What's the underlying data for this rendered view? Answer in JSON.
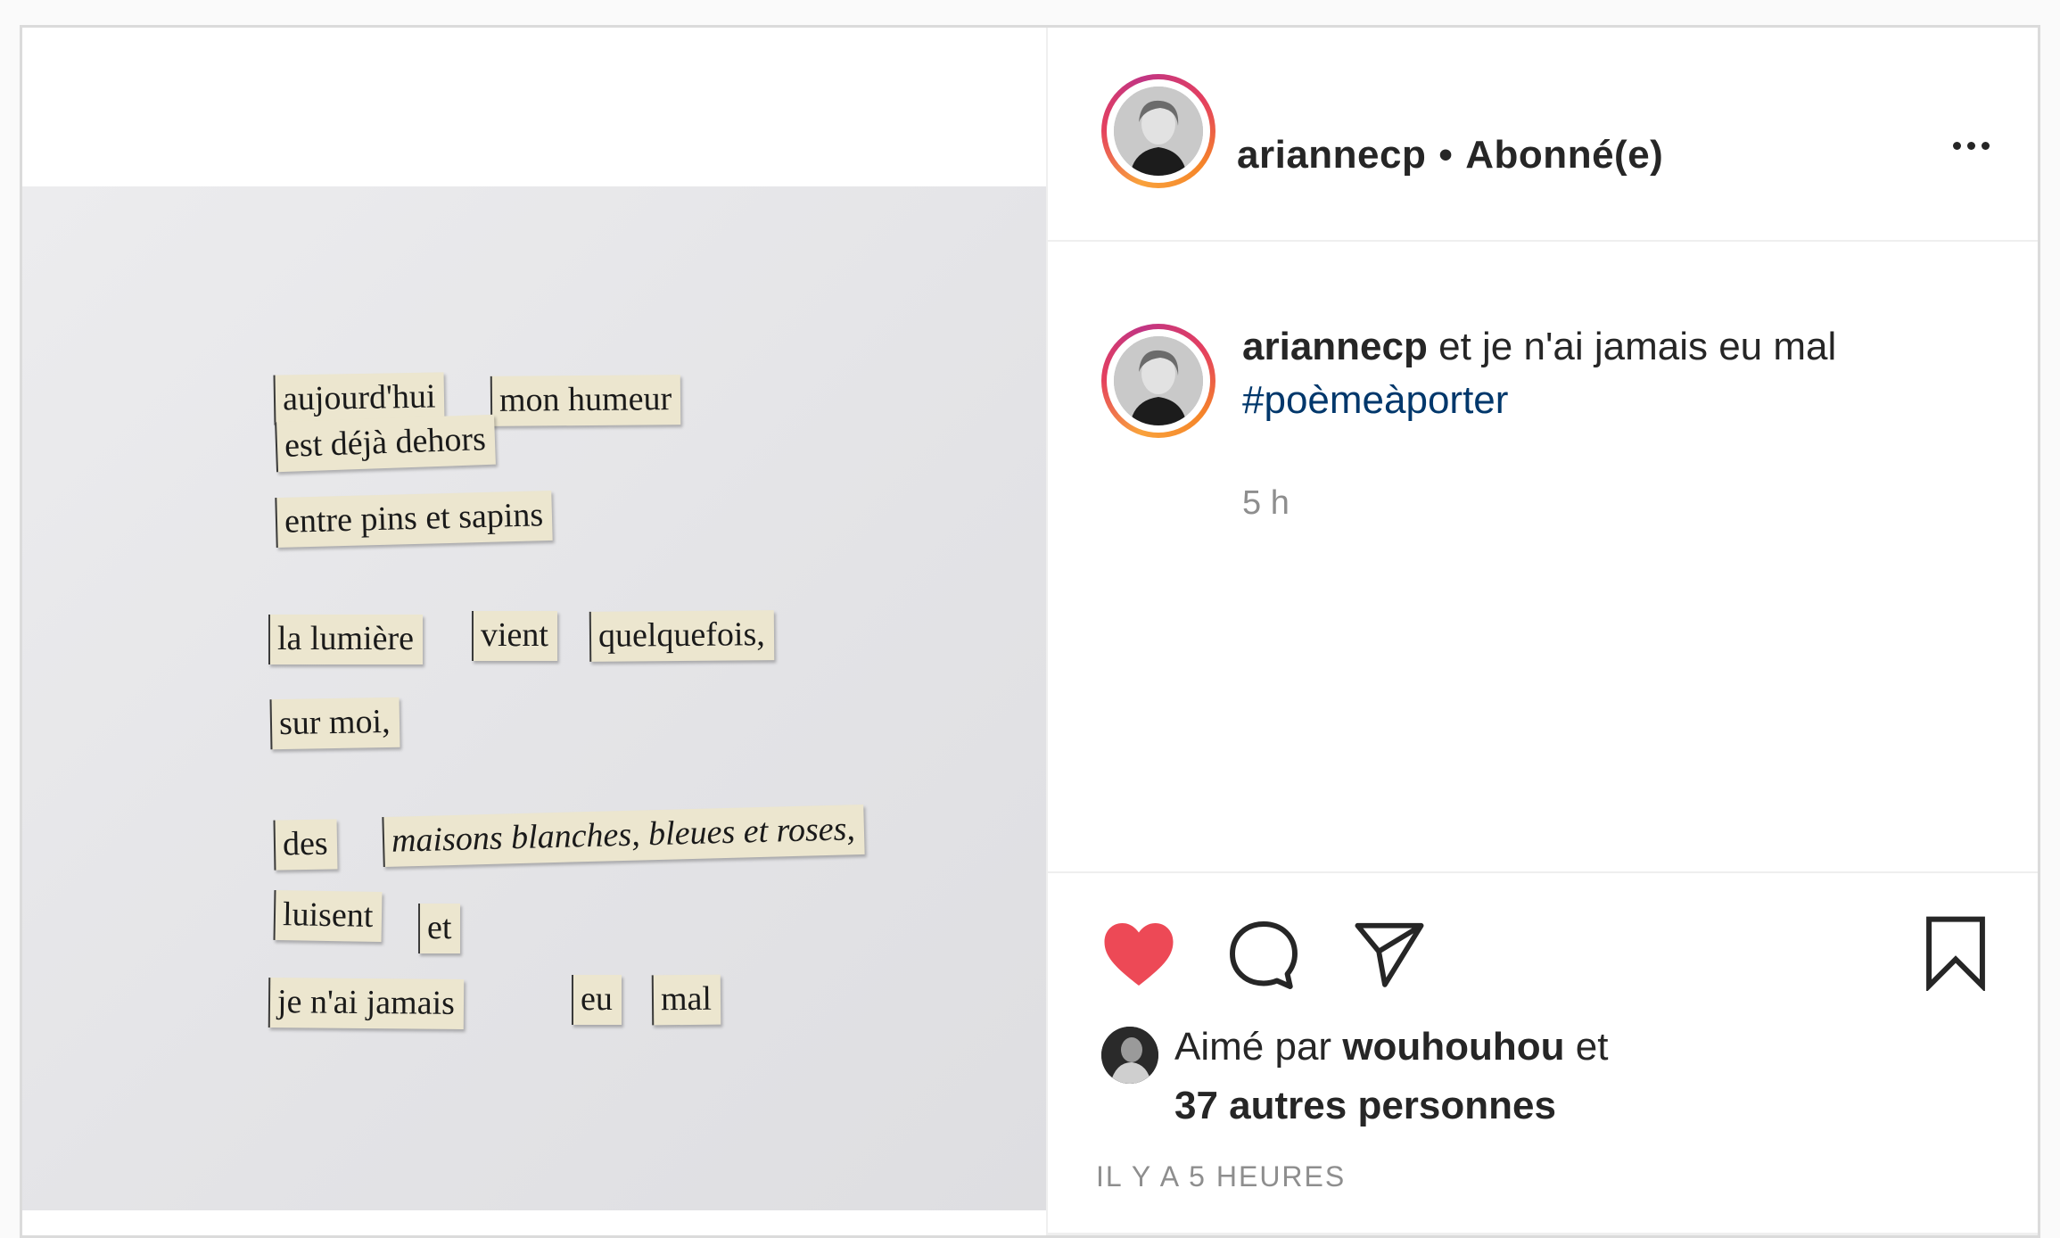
{
  "post": {
    "poem_snippets": [
      {
        "text": "aujourd'hui",
        "italic": false
      },
      {
        "text": "mon humeur",
        "italic": false
      },
      {
        "text": "est déjà dehors",
        "italic": false
      },
      {
        "text": "entre pins et sapins",
        "italic": false
      },
      {
        "text": "la lumière",
        "italic": false
      },
      {
        "text": "vient",
        "italic": false
      },
      {
        "text": "quelquefois,",
        "italic": false
      },
      {
        "text": "sur moi,",
        "italic": false
      },
      {
        "text": "des",
        "italic": false
      },
      {
        "text": "maisons blanches, bleues et roses,",
        "italic": true
      },
      {
        "text": "luisent",
        "italic": false
      },
      {
        "text": "et",
        "italic": false
      },
      {
        "text": "je n'ai jamais",
        "italic": false
      },
      {
        "text": "eu",
        "italic": false
      },
      {
        "text": "mal",
        "italic": false
      }
    ]
  },
  "header": {
    "username": "ariannecp",
    "separator": "•",
    "follow_status": "Abonné(e)",
    "more_icon": "more-horizontal-icon"
  },
  "caption": {
    "username": "ariannecp",
    "text": "et je n'ai jamais eu mal",
    "hashtag": "#poèmeàporter",
    "time": "5 h"
  },
  "actions": {
    "like_icon": "heart-filled-icon",
    "comment_icon": "comment-icon",
    "share_icon": "paper-plane-icon",
    "save_icon": "bookmark-icon",
    "like_color": "#ed4956"
  },
  "likes": {
    "prefix": "Aimé par",
    "user": "wouhouhou",
    "conjunction": "et",
    "others": "37 autres personnes"
  },
  "timestamp": "IL Y A 5 HEURES"
}
